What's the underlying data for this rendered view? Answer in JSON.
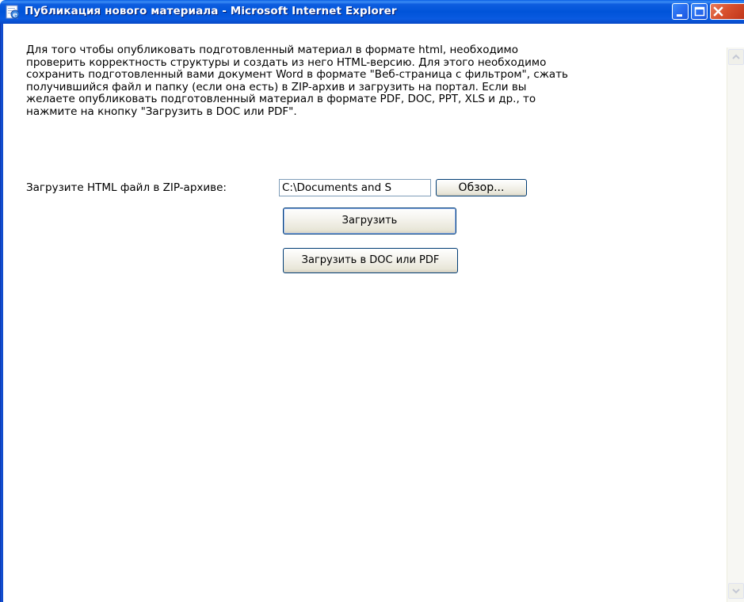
{
  "window": {
    "title": "Публикация нового материала - Microsoft Internet Explorer"
  },
  "content": {
    "intro_lines": [
      "Для того чтобы опубликовать подготовленный материал в формате html, необходимо",
      "проверить корректность структуры и создать из него HTML-версию. Для этого необходимо",
      "сохранить подготовленный вами документ Word в формате \"Веб-страница с фильтром\", сжать",
      "получившийся файл и папку (если она есть) в ZIP-архив и загрузить на портал. Если вы",
      "желаете опубликовать подготовленный материал в формате PDF, DOC, PPT, XLS и др., то",
      "нажмите на кнопку \"Загрузить в DOC или PDF\"."
    ],
    "upload_label": "Загрузите HTML файл в ZIP-архиве:",
    "file_input_value": "C:\\Documents and S",
    "browse_label": "Обзор...",
    "upload_button_label": "Загрузить",
    "upload_doc_button_label": "Загрузить в DOC или PDF"
  },
  "icons": {
    "title_icon": "ie-page-icon",
    "minimize": "minimize-icon",
    "maximize": "maximize-icon",
    "close": "close-icon",
    "scroll_up": "chevron-up-icon",
    "scroll_down": "chevron-down-icon"
  },
  "colors": {
    "titlebar_blue": "#0054d9",
    "close_red": "#d8512e",
    "button_border": "#003c74"
  }
}
